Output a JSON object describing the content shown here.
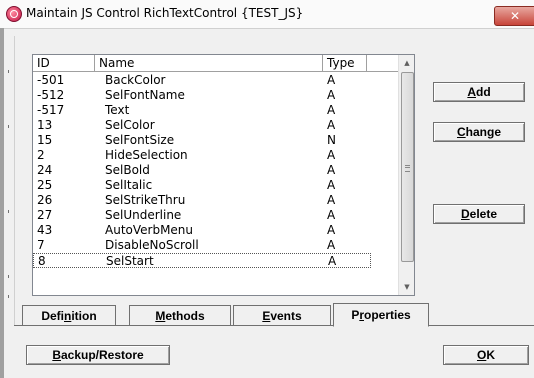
{
  "window": {
    "title": "Maintain JS Control RichTextControl {TEST_JS}",
    "close_label": "✕"
  },
  "table": {
    "columns": [
      "ID",
      "Name",
      "Type"
    ],
    "rows": [
      {
        "id": "-501",
        "name": "BackColor",
        "type": "A"
      },
      {
        "id": "-512",
        "name": "SelFontName",
        "type": "A"
      },
      {
        "id": "-517",
        "name": "Text",
        "type": "A"
      },
      {
        "id": "13",
        "name": "SelColor",
        "type": "A"
      },
      {
        "id": "15",
        "name": "SelFontSize",
        "type": "N"
      },
      {
        "id": "2",
        "name": "HideSelection",
        "type": "A"
      },
      {
        "id": "24",
        "name": "SelBold",
        "type": "A"
      },
      {
        "id": "25",
        "name": "SelItalic",
        "type": "A"
      },
      {
        "id": "26",
        "name": "SelStrikeThru",
        "type": "A"
      },
      {
        "id": "27",
        "name": "SelUnderline",
        "type": "A"
      },
      {
        "id": "43",
        "name": "AutoVerbMenu",
        "type": "A"
      },
      {
        "id": "7",
        "name": "DisableNoScroll",
        "type": "A"
      },
      {
        "id": "8",
        "name": "SelStart",
        "type": "A"
      }
    ]
  },
  "buttons": {
    "add": {
      "prefix": "",
      "accel": "A",
      "rest": "dd"
    },
    "change": {
      "prefix": "",
      "accel": "C",
      "rest": "hange"
    },
    "delete": {
      "prefix": "",
      "accel": "D",
      "rest": "elete"
    },
    "backup": {
      "prefix": "",
      "accel": "B",
      "rest": "ackup/Restore"
    },
    "ok": {
      "prefix": "",
      "accel": "O",
      "rest": "K"
    }
  },
  "tabs": [
    {
      "prefix": "Defi",
      "accel": "n",
      "rest": "ition"
    },
    {
      "prefix": "",
      "accel": "M",
      "rest": "ethods"
    },
    {
      "prefix": "",
      "accel": "E",
      "rest": "vents"
    },
    {
      "prefix": "P",
      "accel": "r",
      "rest": "operties"
    }
  ],
  "active_tab": "Properties"
}
